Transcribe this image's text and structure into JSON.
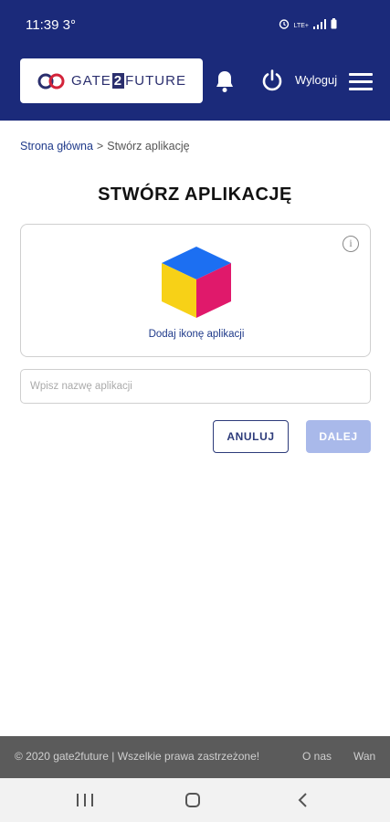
{
  "status_bar": {
    "time": "11:39",
    "temperature": "3°",
    "network": "LTE+"
  },
  "header": {
    "logo": {
      "part1": "GATE",
      "part2": "2",
      "part3": "FUTURE"
    },
    "logout_label": "Wyloguj",
    "icons": [
      "bell-icon",
      "power-icon",
      "hamburger-menu-icon"
    ]
  },
  "breadcrumb": {
    "home": "Strona główna",
    "separator": ">",
    "current": "Stwórz aplikację"
  },
  "page": {
    "title": "STWÓRZ APLIKACJĘ",
    "icon_card": {
      "add_icon_label": "Dodaj ikonę aplikacji",
      "info_icon": "i"
    },
    "name_input": {
      "placeholder": "Wpisz nazwę aplikacji",
      "value": ""
    },
    "buttons": {
      "cancel": "ANULUJ",
      "next": "DALEJ"
    }
  },
  "footer": {
    "copyright": "© 2020 gate2future | Wszelkie prawa zastrzeżone!",
    "about": "O nas",
    "more": "Wan"
  },
  "colors": {
    "brand_navy": "#1b2a7a",
    "link_blue": "#1f3a8a",
    "disabled_button": "#a9b9ea",
    "footer_gray": "#5b5b5b"
  }
}
